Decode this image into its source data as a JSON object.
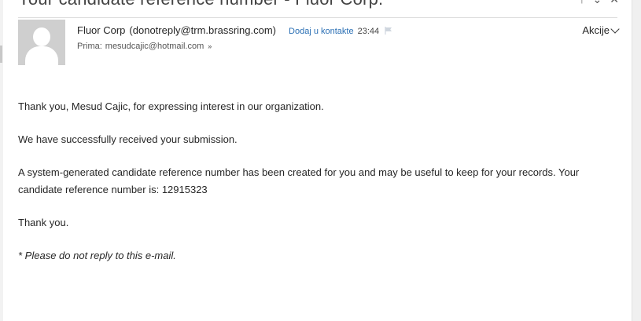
{
  "message": {
    "subject": "Your candidate reference number - Fluor Corp.",
    "sender_name": "Fluor Corp",
    "sender_email": "(donotreply@trm.brassring.com)",
    "add_contact_label": "Dodaj u kontakte",
    "time": "23:44",
    "recipient_label": "Prima:",
    "recipient_email": "mesudcajic@hotmail.com",
    "actions_label": "Akcije"
  },
  "body": {
    "p1": "Thank you, Mesud Cajic, for expressing interest in our organization.",
    "p2": "We have successfully received your submission.",
    "p3": "A system-generated candidate reference number has been created for you and may be useful to keep for your records. Your candidate reference number is: 12915323",
    "p4": "Thank you.",
    "p5": "* Please do not reply to this e-mail."
  },
  "icons": {
    "top_icons": [
      "up-arrow-icon",
      "chevron-down-icon",
      "close-icon"
    ],
    "flag": "flag-icon",
    "expand": "double-chevron-down-icon",
    "avatar": "person-silhouette-icon"
  },
  "colors": {
    "link": "#2a6fb4",
    "text": "#262626",
    "avatar_bg": "#cfcfcf"
  }
}
